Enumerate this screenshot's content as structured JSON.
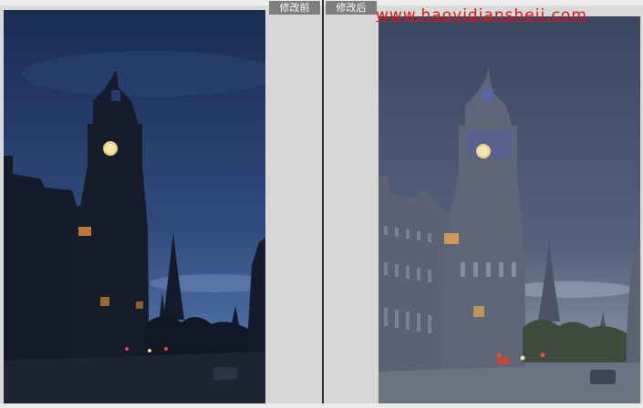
{
  "panes": {
    "before": {
      "label": "修改前"
    },
    "after": {
      "label": "修改后"
    }
  },
  "watermark": {
    "text": "www.haoyidiansheji.com"
  },
  "colors": {
    "background": "#d9d9d9",
    "label_bg": "#7e7e7e",
    "label_text": "#ffffff",
    "divider": "#2b2b2b",
    "watermark": "#e0121b",
    "before_sky_top": "#1a2c52",
    "before_sky_bottom": "#3e5f95",
    "after_sky_top": "#3b4760",
    "after_sky_bottom": "#6c7790"
  }
}
